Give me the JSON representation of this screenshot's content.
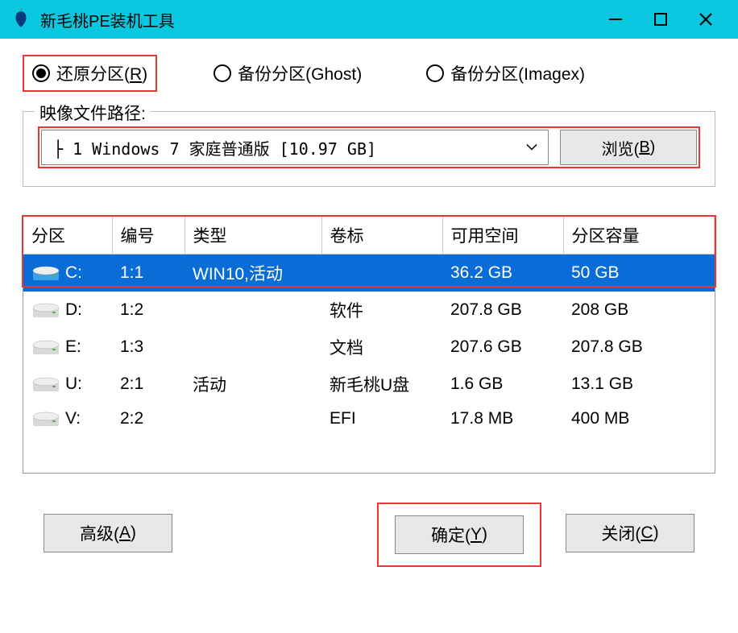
{
  "titlebar": {
    "title": "新毛桃PE装机工具"
  },
  "radios": {
    "restore": "还原分区(R)",
    "backup_ghost": "备份分区(Ghost)",
    "backup_imagex": "备份分区(Imagex)"
  },
  "group": {
    "legend": "映像文件路径:",
    "selected": "├ 1 Windows 7 家庭普通版 [10.97 GB]",
    "browse": "浏览(B)"
  },
  "table": {
    "headers": {
      "partition": "分区",
      "number": "编号",
      "type": "类型",
      "label": "卷标",
      "free": "可用空间",
      "capacity": "分区容量"
    },
    "rows": [
      {
        "icon": "blue",
        "partition": "C:",
        "number": "1:1",
        "type": "WIN10,活动",
        "label": "",
        "free": "36.2 GB",
        "capacity": "50 GB",
        "selected": true
      },
      {
        "icon": "gray",
        "partition": "D:",
        "number": "1:2",
        "type": "",
        "label": "软件",
        "free": "207.8 GB",
        "capacity": "208 GB",
        "selected": false
      },
      {
        "icon": "gray",
        "partition": "E:",
        "number": "1:3",
        "type": "",
        "label": "文档",
        "free": "207.6 GB",
        "capacity": "207.8 GB",
        "selected": false
      },
      {
        "icon": "gray",
        "partition": "U:",
        "number": "2:1",
        "type": "活动",
        "label": "新毛桃U盘",
        "free": "1.6 GB",
        "capacity": "13.1 GB",
        "selected": false
      },
      {
        "icon": "gray",
        "partition": "V:",
        "number": "2:2",
        "type": "",
        "label": "EFI",
        "free": "17.8 MB",
        "capacity": "400 MB",
        "selected": false
      }
    ]
  },
  "footer": {
    "advanced": "高级(A)",
    "ok": "确定(Y)",
    "close": "关闭(C)"
  }
}
